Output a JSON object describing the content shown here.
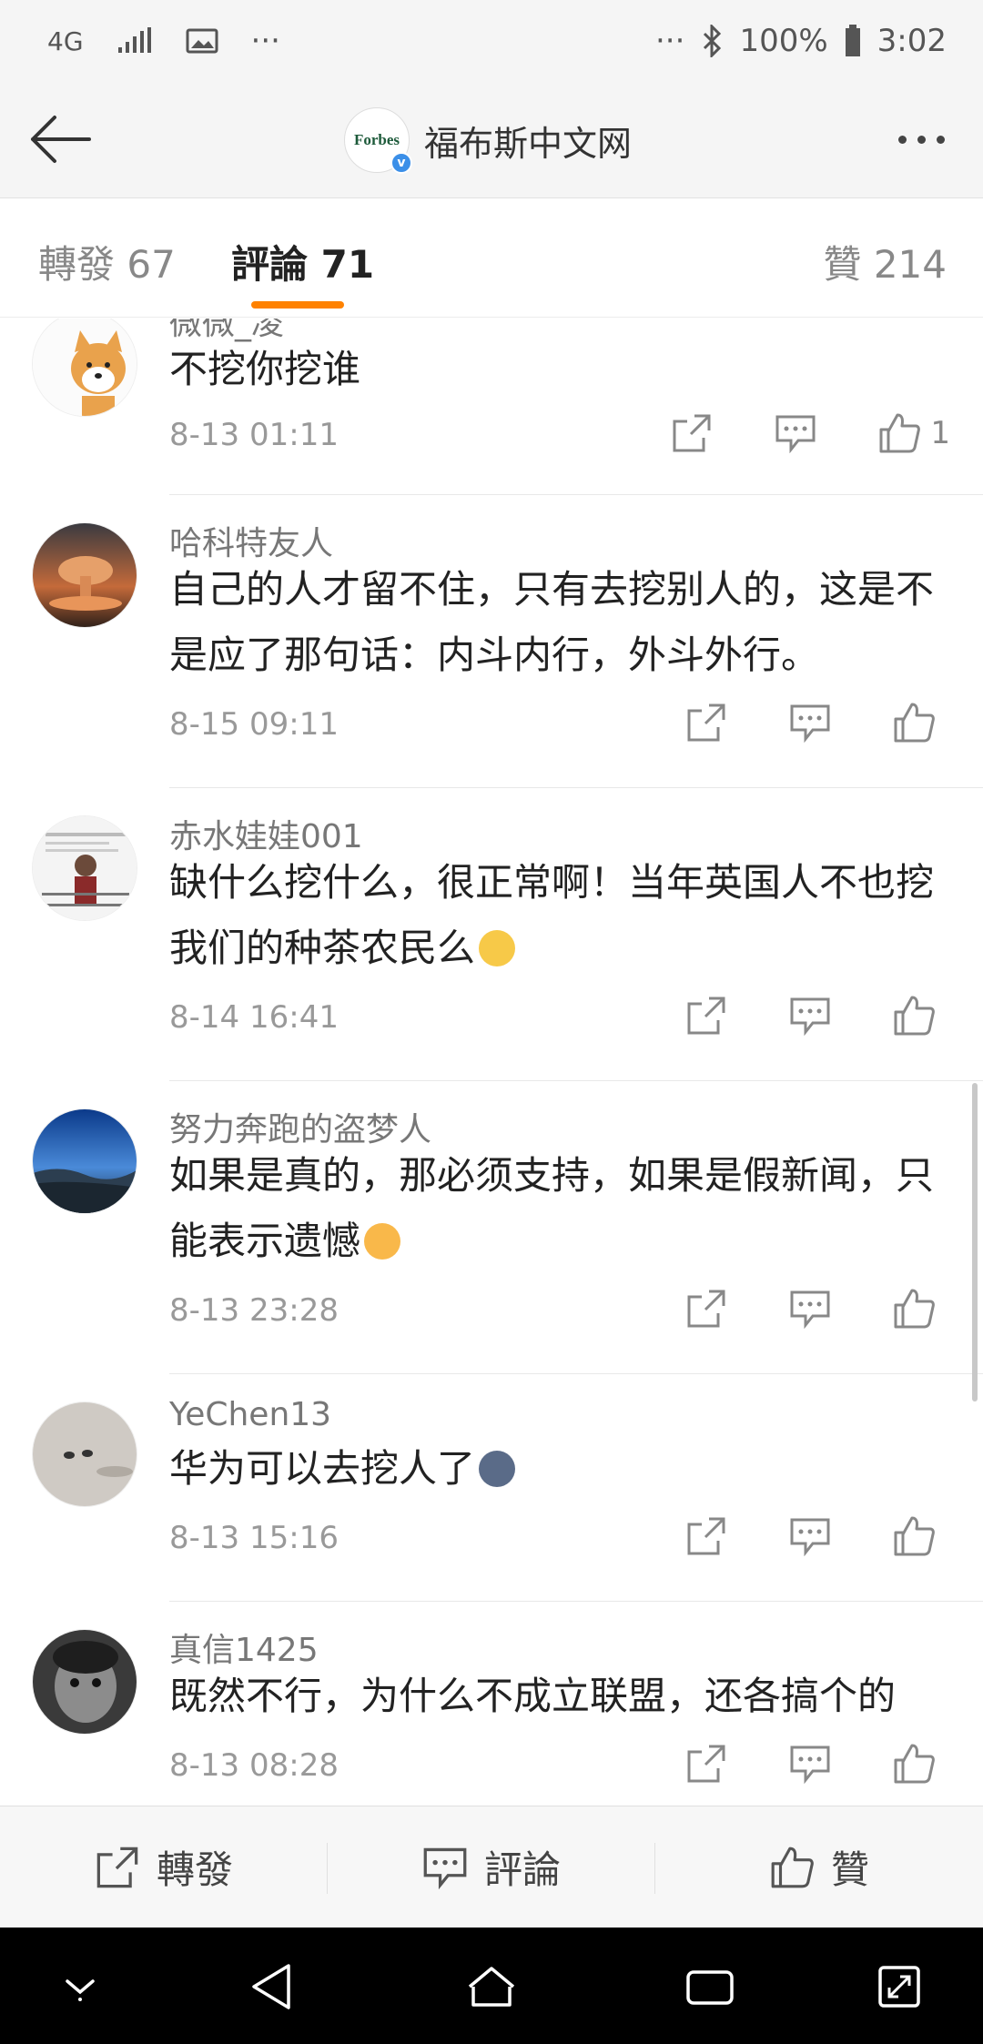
{
  "status_bar": {
    "network": "4G",
    "dots": "···",
    "battery": "100%",
    "time": "3:02"
  },
  "header": {
    "title": "福布斯中文网",
    "logo_text": "Forbes",
    "verified_mark": "v"
  },
  "tabs": {
    "repost": "轉發 67",
    "comment": "評論 71",
    "like": "贊 214"
  },
  "comments": [
    {
      "name": "微微_凌",
      "text": "不挖你挖谁",
      "date": "8-13 01:11",
      "likes": "1"
    },
    {
      "name": "哈科特友人",
      "text": "自己的人才留不住，只有去挖别人的，这是不是应了那句话：内斗内行，外斗外行。",
      "date": "8-15 09:11",
      "likes": ""
    },
    {
      "name": "赤水娃娃001",
      "text": "缺什么挖什么，很正常啊！当年英国人不也挖我们的种茶农民么",
      "date": "8-14 16:41",
      "likes": ""
    },
    {
      "name": "努力奔跑的盗梦人",
      "text": "如果是真的，那必须支持，如果是假新闻，只能表示遗憾",
      "date": "8-13 23:28",
      "likes": ""
    },
    {
      "name": "YeChen13",
      "text": "华为可以去挖人了",
      "date": "8-13 15:16",
      "likes": ""
    },
    {
      "name": "真信1425",
      "text": "既然不行，为什么不成立联盟，还各搞个的",
      "date": "8-13 08:28",
      "likes": ""
    }
  ],
  "bottom_bar": {
    "repost": "轉發",
    "comment": "評論",
    "like": "贊"
  },
  "colors": {
    "accent": "#ff8200",
    "verified": "#3b8fe8"
  }
}
